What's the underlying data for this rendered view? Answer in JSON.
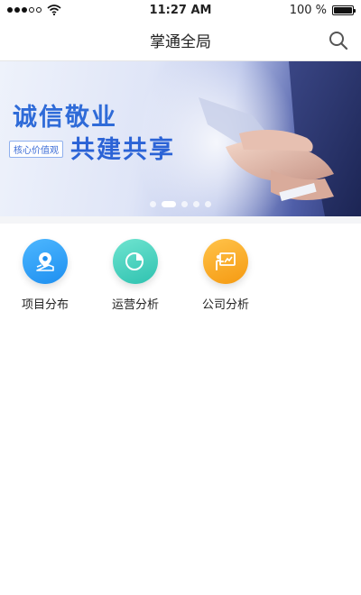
{
  "status_bar": {
    "time": "11:27 AM",
    "battery": "100 %",
    "battery_level": 1.0
  },
  "nav": {
    "title": "掌通全局",
    "search_icon": "search-icon"
  },
  "banner": {
    "title": "诚信敬业",
    "tag": "核心价值观",
    "subtitle": "共建共享",
    "slide_count": 5,
    "active_slide": 2
  },
  "menu": {
    "items": [
      {
        "label": "项目分布",
        "icon": "map-pin-icon",
        "color": "#1e8ff0"
      },
      {
        "label": "运营分析",
        "icon": "pie-chart-icon",
        "color": "#2fc2b0"
      },
      {
        "label": "公司分析",
        "icon": "presentation-board-icon",
        "color": "#f59a12"
      }
    ]
  }
}
